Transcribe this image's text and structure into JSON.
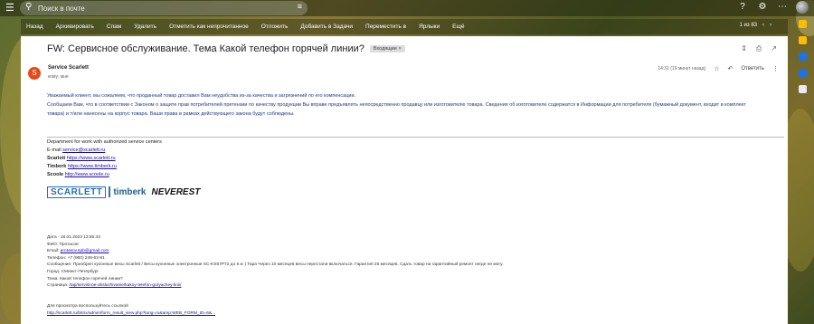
{
  "search": {
    "placeholder": "Поиск в почте"
  },
  "toolbar": {
    "items": [
      "Назад",
      "Архивировать",
      "Спам",
      "Удалить",
      "Отметить как непрочитанное",
      "Отложить",
      "Добавить в Задачи",
      "Переместить в",
      "Ярлыки",
      "Ещё"
    ],
    "pager": "1 из 83"
  },
  "message": {
    "subject": "FW: Сервисное обслуживание. Тема Какой телефон горячей линии?",
    "label": "Входящие ×",
    "sender_initial": "S",
    "sender_name": "Service Scarlett",
    "to": "кому: мне",
    "time": "14:31 (19 минут назад)",
    "reply": "Ответить",
    "body_line1": "Уважаемый клиент, мы сожалеем, что проданный товар доставил Вам неудобства из-за качества и загрязнений по его компенсации.",
    "body_line2": "Сообщаем Вам, что в соответствии с Законом о защите прав потребителей претензии по качеству продукции Вы вправе предъявлять непосредственно продавцу или изготовителю товара. Сведения об изготовителе содержатся в Информации для потребителя (бумажный документ, входит в комплект",
    "body_line3": "товара) и т/или нанесены на корпус товара. Ваши права в рамках действующего закона будут соблюдены."
  },
  "signature": {
    "dept": "Department for work with authorized service centers",
    "email_label": "E-mail",
    "email": "service@scarlett.ru",
    "scarlett_label": "Scarlett",
    "scarlett_url": "https://www.scarlett.ru",
    "timberk_label": "Timberk",
    "timberk_url": "https://www.timberk.ru",
    "scoole_label": "Scoole",
    "scoole_url": "http://www.scoole.ru"
  },
  "brands": {
    "scarlett": "SCARLETT",
    "timberk": "timberk",
    "neverest": "NEVEREST"
  },
  "form": {
    "date": "Дата - 18.01.2023 13:55:43",
    "fio": "ФИО: Протасов",
    "email_label": "Email:",
    "email": "protasov.spb@gmail.com",
    "phone": "Телефон: +7 (960) 248-63-81",
    "message": "Сообщение: Приобрел кухонные весы Scarlett / Весы кухонные электронные SC-KS57P72 до 5 кг | Тара Через 10 месяцев весы перестали включаться. Гарантия 25 месяцев. Сдать товар на гарантийный ремонт негде не могу.",
    "city": "Город: СМинкт-Петербург",
    "topic": "Тема: Какой телефон горячей линии?",
    "page_label": "Страница:",
    "page_url": "/tap/servisnoe-obsluzhivanie/kakoy-telefon-goryachey-linii/"
  },
  "footer": {
    "note": "Для просмотра воспользуйтесь ссылкой",
    "link": "http://scarlett.ru/bitrix/admin/form_result_view.php?lang=ru&amp;WEB_FORM_ID=6&..."
  }
}
